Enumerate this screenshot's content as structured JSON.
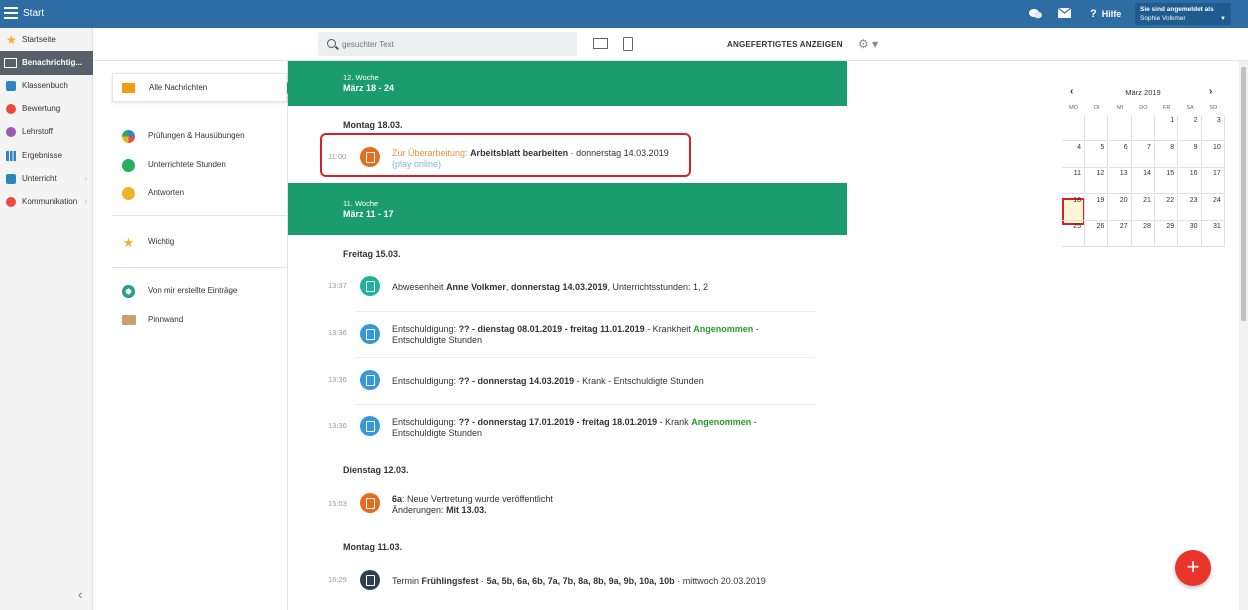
{
  "topbar": {
    "title": "Start",
    "help_label": "Hilfe",
    "help_glyph": "?",
    "user_caption": "Sie sind angemeldet als",
    "user_name": "Sophie Volkmer",
    "bg_color": "#2e6da4"
  },
  "sidebar": {
    "items": [
      {
        "label": "Startseite",
        "icon": "star-icon",
        "color": "#f0b323"
      },
      {
        "label": "Benachrichtig...",
        "icon": "mail-icon",
        "color": "#ffffff"
      },
      {
        "label": "Klassenbuch",
        "icon": "book-icon",
        "color": "#2e86c1"
      },
      {
        "label": "Bewertung",
        "icon": "grade-icon",
        "color": "#e74c3c"
      },
      {
        "label": "Lehrstoff",
        "icon": "material-icon",
        "color": "#9b59b6"
      },
      {
        "label": "Ergebnisse",
        "icon": "chart-icon",
        "color": "#2e86c1"
      },
      {
        "label": "Unterricht",
        "icon": "lesson-icon",
        "color": "#2e86c1"
      },
      {
        "label": "Kommunikation",
        "icon": "communication-icon",
        "color": "#e74c3c"
      }
    ],
    "collapse_glyph": "‹"
  },
  "toolbar": {
    "search_placeholder": "gesuchter Text",
    "show_done_label": "ANGEFERTIGTES ANZEIGEN",
    "gear_glyph": "⚙ ▾"
  },
  "filters": {
    "all": "Alle Nachrichten",
    "exams": "Prüfungen & Hausübungen",
    "lessons": "Unterrichtete Stunden",
    "answers": "Antworten",
    "important": "Wichtig",
    "created": "Von mir erstellte Einträge",
    "board": "Pinnwand"
  },
  "feed": {
    "week12": {
      "label": "12. Woche",
      "range": "März 18 - 24"
    },
    "day_mon18": "Montag 18.03.",
    "e1": {
      "time": "11:00",
      "prefix": "Zur Überarbeitung:",
      "title": "Arbeitsblatt bearbeiten",
      "sep": "-",
      "date": "donnerstag 14.03.2019",
      "link": "(play online)"
    },
    "week11": {
      "label": "11. Woche",
      "range": "März 11 - 17"
    },
    "day_fri15": "Freitag 15.03.",
    "e2": {
      "time": "13:37",
      "a": "Abwesenheit",
      "b": "Anne Volkmer",
      "c": ",",
      "d": "donnerstag 14.03.2019",
      "e": ", Unterrichtsstunden: 1, 2"
    },
    "e3": {
      "time": "13:36",
      "a": "Entschuldigung:",
      "b": "?? - dienstag 08.01.2019 - freitag 11.01.2019",
      "c": "- Krankheit",
      "d": "Angenommen",
      "e": "-",
      "f": "Entschuldigte Stunden"
    },
    "e4": {
      "time": "13:36",
      "a": "Entschuldigung:",
      "b": "?? - donnerstag 14.03.2019",
      "c": "- Krank - Entschuldigte Stunden"
    },
    "e5": {
      "time": "13:36",
      "a": "Entschuldigung:",
      "b": "?? - donnerstag 17.01.2019 - freitag 18.01.2019",
      "c": "- Krank",
      "d": "Angenommen",
      "e": "-",
      "f": "Entschuldigte Stunden"
    },
    "day_tue12": "Dienstag 12.03.",
    "e6": {
      "time": "15:03",
      "a": "6a",
      "b": ": Neue Vertretung wurde veröffentlicht",
      "c": "Änderungen:",
      "d": "Mit 13.03."
    },
    "day_mon11": "Montag 11.03.",
    "e7": {
      "time": "16:29",
      "a": "Termin",
      "b": "Frühlingsfest",
      "c": "·",
      "d": "5a, 5b, 6a, 6b, 7a, 7b, 8a, 8b, 9a, 9b, 10a, 10b",
      "e": "· mittwoch 20.03.2019"
    },
    "accent_color": "#1a9c6e"
  },
  "calendar": {
    "title": "März 2019",
    "prev": "‹",
    "next": "›",
    "weekdays": [
      "MO",
      "DI",
      "MI",
      "DO",
      "FR",
      "SA",
      "SO"
    ],
    "weeks": [
      [
        "",
        "",
        "",
        "",
        "1",
        "2",
        "3"
      ],
      [
        "4",
        "5",
        "6",
        "7",
        "8",
        "9",
        "10"
      ],
      [
        "11",
        "12",
        "13",
        "14",
        "15",
        "16",
        "17"
      ],
      [
        "18",
        "19",
        "20",
        "21",
        "22",
        "23",
        "24"
      ],
      [
        "25",
        "26",
        "27",
        "28",
        "29",
        "30",
        "31"
      ]
    ],
    "today": "18"
  },
  "fab": {
    "label": "+",
    "color": "#e8342a"
  }
}
